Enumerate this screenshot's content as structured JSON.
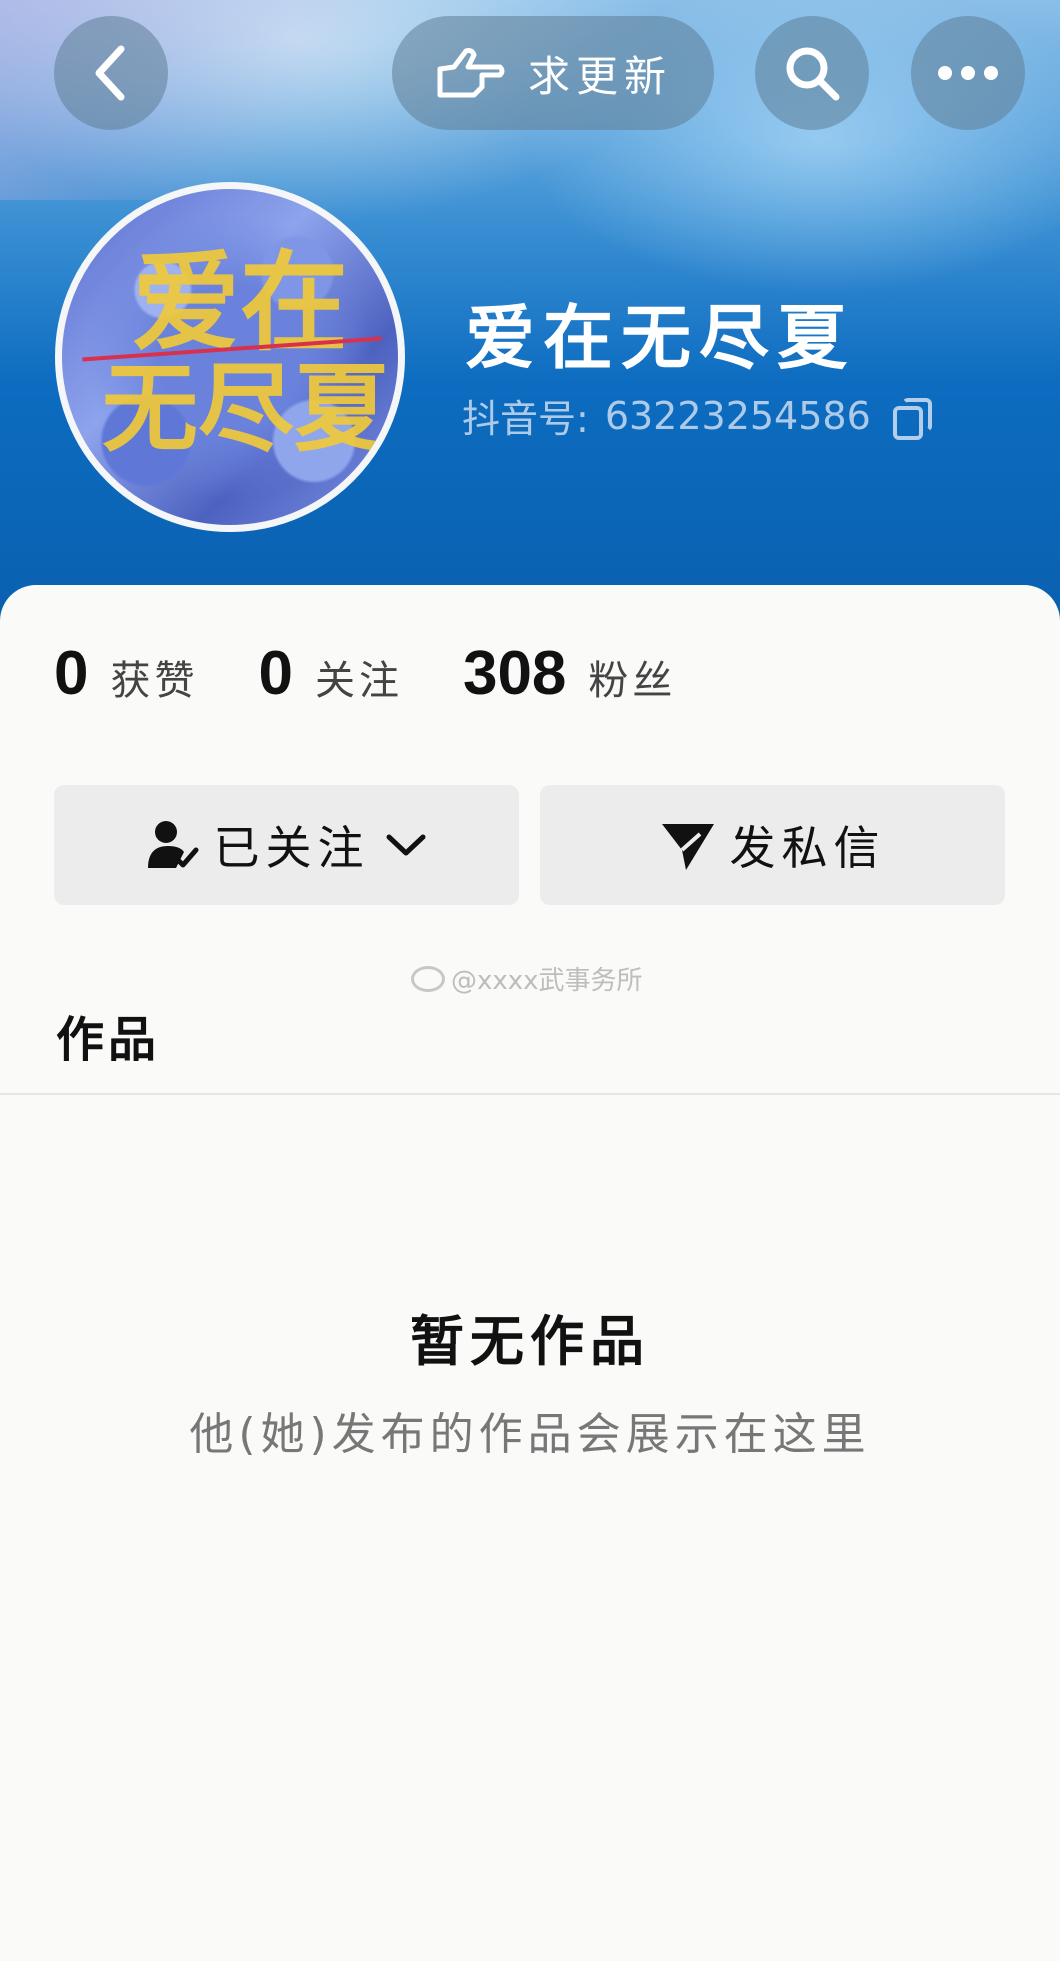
{
  "header": {
    "update_label": "求更新"
  },
  "profile": {
    "username": "爱在无尽夏",
    "id_label": "抖音号:",
    "id_value": "63223254586",
    "avatar_text": [
      "爱在",
      "无尽夏"
    ]
  },
  "stats": [
    {
      "value": "0",
      "label": "获赞"
    },
    {
      "value": "0",
      "label": "关注"
    },
    {
      "value": "308",
      "label": "粉丝"
    }
  ],
  "actions": {
    "follow_label": "已关注",
    "message_label": "发私信"
  },
  "watermark": "@xxxx武事务所",
  "tabs": {
    "works": "作品"
  },
  "empty_state": {
    "title": "暂无作品",
    "subtitle": "他(她)发布的作品会展示在这里"
  },
  "icons": [
    "back-icon",
    "hand-pointer-icon",
    "search-icon",
    "more-icon",
    "copy-icon",
    "user-check-icon",
    "chevron-down-icon",
    "send-icon",
    "weibo-icon"
  ],
  "colors": {
    "header_blue": "#0a5fae",
    "button_gray": "#ececec",
    "page_bg": "#fafaf9"
  }
}
